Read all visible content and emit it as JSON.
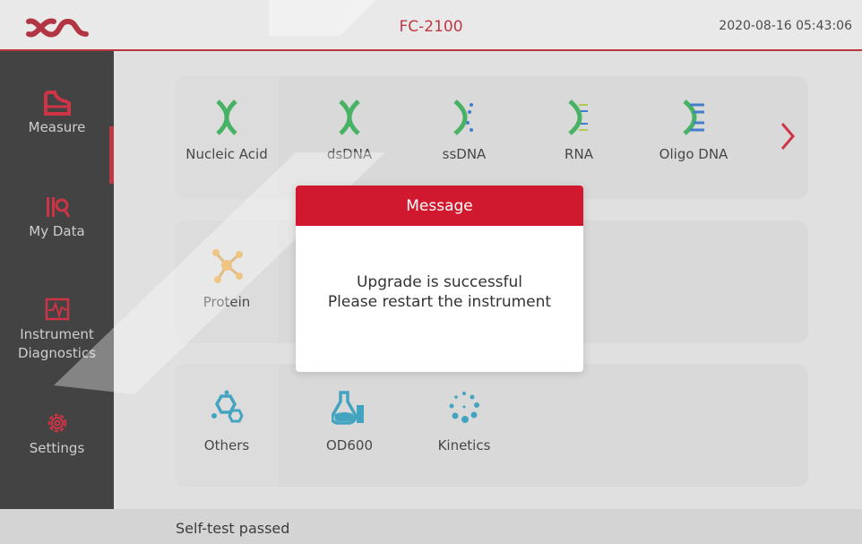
{
  "header": {
    "title": "FC-2100",
    "datetime": "2020-08-16 05:43:06"
  },
  "sidebar": {
    "items": [
      {
        "label": "Measure",
        "icon": "measure-icon"
      },
      {
        "label": "My Data",
        "icon": "my-data-icon"
      },
      {
        "label_line1": "Instrument",
        "label_line2": "Diagnostics",
        "icon": "diagnostics-icon"
      },
      {
        "label": "Settings",
        "icon": "gear-icon"
      }
    ]
  },
  "cards": {
    "nucleic": {
      "lead": "Nucleic Acid",
      "tiles": [
        "dsDNA",
        "ssDNA",
        "RNA",
        "Oligo DNA"
      ]
    },
    "protein": {
      "lead": "Protein"
    },
    "others": {
      "lead": "Others",
      "tiles": [
        "OD600",
        "Kinetics"
      ]
    }
  },
  "status": {
    "text": "Self-test passed"
  },
  "dialog": {
    "title": "Message",
    "line1": "Upgrade is successful",
    "line2": "Please restart the instrument"
  },
  "colors": {
    "accent": "#d0192e",
    "sidebar": "#2a2a2a",
    "dna_green": "#2fa84f",
    "dna_blue": "#2b6cc4"
  }
}
